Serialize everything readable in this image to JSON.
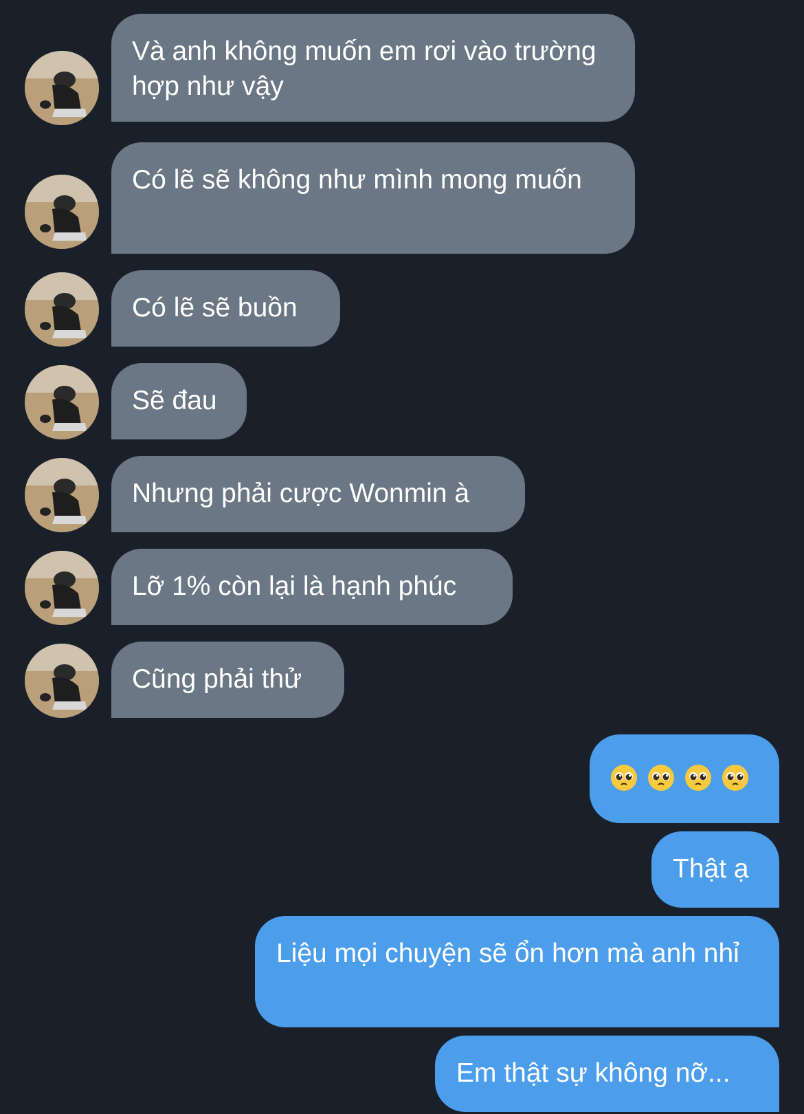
{
  "conversation": {
    "received": [
      {
        "text": "Và anh không muốn em rơi vào trường hợp như vậy"
      },
      {
        "text": "Có lẽ sẽ không như mình mong muốn"
      },
      {
        "text": "Có lẽ sẽ buồn"
      },
      {
        "text": "Sẽ đau"
      },
      {
        "text": "Nhưng phải cược Wonmin à"
      },
      {
        "text": "Lỡ 1% còn lại là hạnh phúc"
      },
      {
        "text": "Cũng phải thử"
      }
    ],
    "sent": [
      {
        "emoji": [
          "pleading-face",
          "pleading-face",
          "pleading-face",
          "pleading-face"
        ]
      },
      {
        "text": "Thật ạ"
      },
      {
        "text": "Liệu mọi chuyện sẽ ổn hơn mà anh nhỉ"
      },
      {
        "text": "Em thật sự không nỡ..."
      }
    ]
  },
  "colors": {
    "background": "#1a202a",
    "received_bubble": "#6b7785",
    "sent_bubble": "#4c9eea",
    "text": "#ffffff"
  }
}
